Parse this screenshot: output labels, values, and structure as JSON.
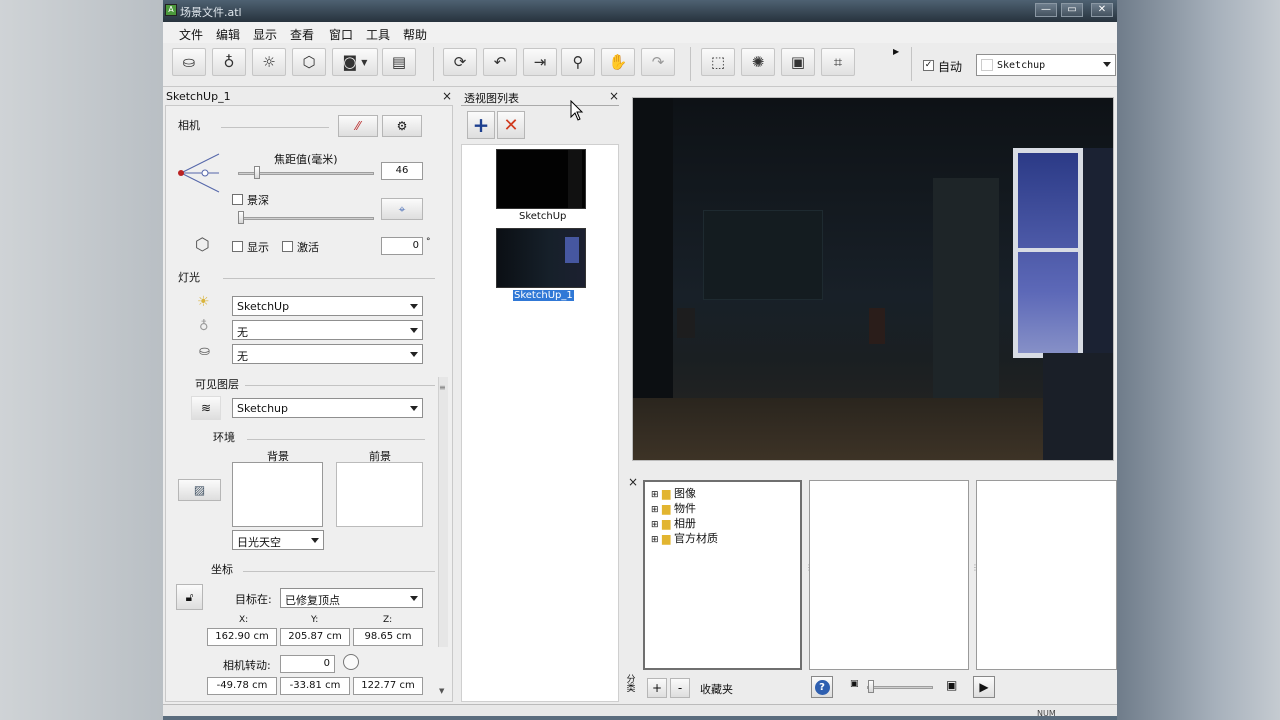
{
  "window": {
    "title": "场景文件.atl",
    "min": "—",
    "max": "▭",
    "close": "✕"
  },
  "menu": [
    "文件",
    "编辑",
    "显示",
    "查看",
    "窗口",
    "工具",
    "帮助"
  ],
  "toolbar": {
    "auto_label": "自动",
    "auto_checked": true,
    "renderer_value": "Sketchup"
  },
  "left_panel": {
    "title": "SketchUp_1",
    "camera_label": "相机",
    "focal_label": "焦距值(毫米)",
    "focal_value": "46",
    "dof_label": "景深",
    "show_label": "显示",
    "activate_label": "激活",
    "angle_value": "0",
    "degree": "°",
    "light_label": "灯光",
    "sun_value": "SketchUp",
    "light2_value": "无",
    "light3_value": "无",
    "layers_label": "可见图层",
    "layers_value": "Sketchup",
    "env_label": "环境",
    "bg_label": "背景",
    "fg_label": "前景",
    "sky_value": "日光天空",
    "coords_label": "坐标",
    "target_label": "目标在:",
    "target_value": "已修复顶点",
    "x_label": "X:",
    "y_label": "Y:",
    "z_label": "Z:",
    "x_value": "162.90 cm",
    "y_value": "205.87 cm",
    "z_value": "98.65 cm",
    "rotate_label": "相机转动:",
    "rotate_value": "0",
    "r1": "-49.78 cm",
    "r2": "-33.81 cm",
    "r3": "122.77 cm"
  },
  "view_list": {
    "title": "透视图列表",
    "items": [
      "SketchUp",
      "SketchUp_1"
    ],
    "selected": "SketchUp_1"
  },
  "library": {
    "tree": [
      "图像",
      "物件",
      "相册",
      "官方材质"
    ],
    "side_label": "分类",
    "fav_label": "收藏夹"
  },
  "status": {
    "num": "NUM"
  }
}
